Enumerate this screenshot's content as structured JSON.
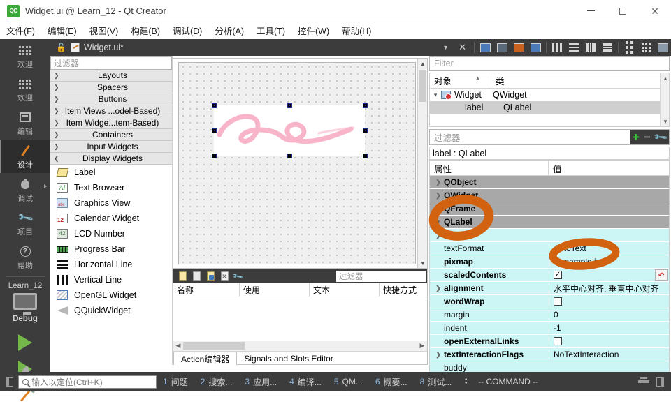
{
  "window": {
    "title": "Widget.ui @ Learn_12 - Qt Creator",
    "app_badge": "QC",
    "minimize": "–",
    "maximize": "□",
    "close": "✕"
  },
  "menubar": {
    "items": [
      {
        "label": "文件(F)"
      },
      {
        "label": "编辑(E)"
      },
      {
        "label": "视图(V)"
      },
      {
        "label": "构建(B)"
      },
      {
        "label": "调试(D)"
      },
      {
        "label": "分析(A)"
      },
      {
        "label": "工具(T)"
      },
      {
        "label": "控件(W)"
      },
      {
        "label": "帮助(H)"
      }
    ]
  },
  "modebar": {
    "modes": [
      {
        "label": "欢迎",
        "icon": "dots-grid-icon",
        "active": false
      },
      {
        "label": "欢迎",
        "icon": "dots-grid-icon",
        "active": false
      },
      {
        "label": "编辑",
        "icon": "edit-icon",
        "active": false
      },
      {
        "label": "设计",
        "icon": "pencil-icon",
        "active": true
      },
      {
        "label": "调试",
        "icon": "bug-icon",
        "active": false
      },
      {
        "label": "项目",
        "icon": "wrench-icon",
        "active": false
      },
      {
        "label": "帮助",
        "icon": "question-mark-icon",
        "active": false
      }
    ],
    "kit_name": "Learn_12",
    "build_config": "Debug",
    "run_label": "run-button",
    "debug_label": "start-debugging-button",
    "build_label": "build-button"
  },
  "widgetbox": {
    "filter_placeholder": "过滤器",
    "categories": [
      {
        "label": "Layouts",
        "expanded": false
      },
      {
        "label": "Spacers",
        "expanded": false
      },
      {
        "label": "Buttons",
        "expanded": false
      },
      {
        "label": "Item Views ...odel-Based)",
        "expanded": false
      },
      {
        "label": "Item Widge...tem-Based)",
        "expanded": false
      },
      {
        "label": "Containers",
        "expanded": false
      },
      {
        "label": "Input Widgets",
        "expanded": false
      },
      {
        "label": "Display Widgets",
        "expanded": true
      }
    ],
    "items": [
      {
        "label": "Label",
        "icon": "label-icon"
      },
      {
        "label": "Text Browser",
        "icon": "text-browser-icon"
      },
      {
        "label": "Graphics View",
        "icon": "graphics-view-icon"
      },
      {
        "label": "Calendar Widget",
        "icon": "calendar-icon"
      },
      {
        "label": "LCD Number",
        "icon": "lcd-number-icon"
      },
      {
        "label": "Progress Bar",
        "icon": "progress-bar-icon"
      },
      {
        "label": "Horizontal Line",
        "icon": "horizontal-line-icon"
      },
      {
        "label": "Vertical Line",
        "icon": "vertical-line-icon"
      },
      {
        "label": "OpenGL Widget",
        "icon": "opengl-widget-icon"
      },
      {
        "label": "QQuickWidget",
        "icon": "qquickwidget-icon"
      }
    ]
  },
  "editor_toolbar": {
    "filename": "Widget.ui*",
    "lock_icon": "unlock-icon",
    "dropdown_icon": "chevron-down-icon",
    "close_icon": "close-document-icon",
    "buttons": [
      "edit-widgets-icon",
      "edit-signals-slots-icon",
      "edit-buddies-icon",
      "edit-tab-order-icon",
      "layout-horizontally-icon",
      "layout-vertically-icon",
      "layout-in-splitter-h-icon",
      "layout-in-splitter-v-icon",
      "layout-in-form-icon",
      "layout-in-grid-icon",
      "break-layout-icon"
    ]
  },
  "canvas": {
    "selected_widget": "label",
    "image_name": "sample.jpg",
    "handles": 8
  },
  "action_editor": {
    "toolbar_icons": [
      "new-action-icon",
      "copy-action-icon",
      "paste-action-icon",
      "delete-action-icon",
      "configure-icon"
    ],
    "filter_placeholder": "过滤器",
    "columns": [
      "名称",
      "使用",
      "文本",
      "快捷方式"
    ],
    "rows": [],
    "tabs": [
      {
        "label": "Action编辑器",
        "active": true
      },
      {
        "label": "Signals and Slots Editor",
        "active": false
      }
    ]
  },
  "object_inspector": {
    "filter_placeholder": "Filter",
    "columns": [
      "对象",
      "类"
    ],
    "rows": [
      {
        "name": "Widget",
        "class": "QWidget",
        "level": 0,
        "expanded": true,
        "selected": false
      },
      {
        "name": "label",
        "class": "QLabel",
        "level": 1,
        "expanded": false,
        "selected": true
      }
    ]
  },
  "property_editor": {
    "filter_placeholder": "过滤器",
    "add_icon": "plus-icon",
    "remove_icon": "minus-icon",
    "config_icon": "wrench-icon",
    "object_line": "label : QLabel",
    "columns": [
      "属性",
      "值"
    ],
    "rows": [
      {
        "name": "QObject",
        "value": "",
        "type": "group",
        "expandable": true,
        "bold": true
      },
      {
        "name": "QWidget",
        "value": "",
        "type": "group",
        "expandable": true,
        "bold": true
      },
      {
        "name": "QFrame",
        "value": "",
        "type": "group",
        "expandable": true,
        "bold": true
      },
      {
        "name": "QLabel",
        "value": "",
        "type": "group",
        "expandable": true,
        "bold": true,
        "expanded": true
      },
      {
        "name": "text",
        "value": "",
        "type": "prop",
        "expandable": true,
        "bold": true
      },
      {
        "name": "textFormat",
        "value": "AutoText",
        "type": "prop",
        "expandable": false,
        "bold": false
      },
      {
        "name": "pixmap",
        "value": "sample.jpg",
        "type": "prop",
        "expandable": false,
        "bold": true
      },
      {
        "name": "scaledContents",
        "value": "checked",
        "type": "checkbox",
        "expandable": false,
        "bold": true,
        "revert": true
      },
      {
        "name": "alignment",
        "value": "水平中心对齐, 垂直中心对齐",
        "type": "prop",
        "expandable": true,
        "bold": true
      },
      {
        "name": "wordWrap",
        "value": "unchecked",
        "type": "checkbox",
        "expandable": false,
        "bold": true
      },
      {
        "name": "margin",
        "value": "0",
        "type": "prop",
        "expandable": false,
        "bold": false
      },
      {
        "name": "indent",
        "value": "-1",
        "type": "prop",
        "expandable": false,
        "bold": false
      },
      {
        "name": "openExternalLinks",
        "value": "unchecked",
        "type": "checkbox",
        "expandable": false,
        "bold": true
      },
      {
        "name": "textInteractionFlags",
        "value": "NoTextInteraction",
        "type": "prop",
        "expandable": true,
        "bold": true
      },
      {
        "name": "buddy",
        "value": "",
        "type": "prop",
        "expandable": false,
        "bold": false
      }
    ]
  },
  "statusbar": {
    "locator_placeholder": "输入以定位(Ctrl+K)",
    "search_icon": "search-icon",
    "panels": [
      {
        "num": "1",
        "label": "问题"
      },
      {
        "num": "2",
        "label": "搜索..."
      },
      {
        "num": "3",
        "label": "应用..."
      },
      {
        "num": "4",
        "label": "编译..."
      },
      {
        "num": "5",
        "label": "QM..."
      },
      {
        "num": "6",
        "label": "概要..."
      },
      {
        "num": "8",
        "label": "测试..."
      }
    ],
    "mode_text": "-- COMMAND --"
  },
  "annotations": {
    "color": "#d2620f",
    "marks": [
      {
        "name": "circle-around-qlabel-text",
        "shape": "ellipse"
      },
      {
        "name": "circle-around-pixmap-value",
        "shape": "ellipse"
      }
    ]
  }
}
